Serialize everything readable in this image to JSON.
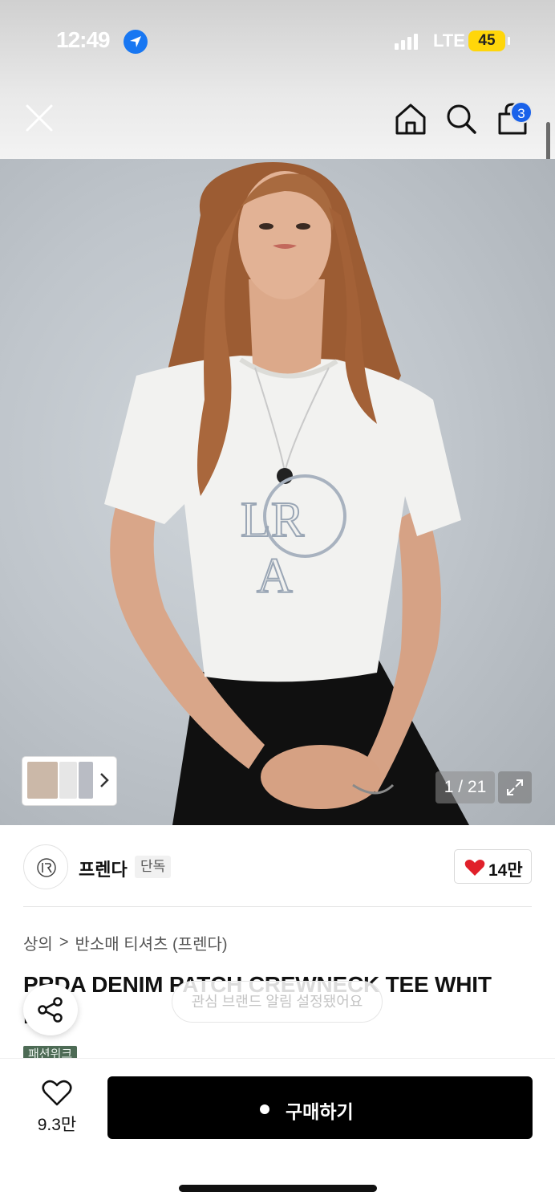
{
  "status_bar": {
    "time": "12:49",
    "network": "LTE",
    "battery": "45"
  },
  "header": {
    "cart_badge": "3"
  },
  "gallery": {
    "pager": "1 / 21"
  },
  "brand": {
    "name": "프렌다",
    "badge": "단독",
    "likes": "14만"
  },
  "breadcrumb": {
    "category": "상의",
    "separator": ">",
    "subcategory": "반소매 티셔츠 (프렌다)"
  },
  "product": {
    "title": "PRDA DENIM PATCH CREWNECK TEE WHIT",
    "title_line2": "E",
    "tag": "패션위크"
  },
  "toast": {
    "text": "관심 브랜드 알림 설정됐어요"
  },
  "bottom_bar": {
    "wish_count": "9.3만",
    "buy_label": "구매하기"
  },
  "colors": {
    "cart_badge": "#1a62ea",
    "buy_button": "#000000",
    "heart": "#e0202a",
    "tag": "#4d6b55",
    "battery": "#ffd60a"
  }
}
